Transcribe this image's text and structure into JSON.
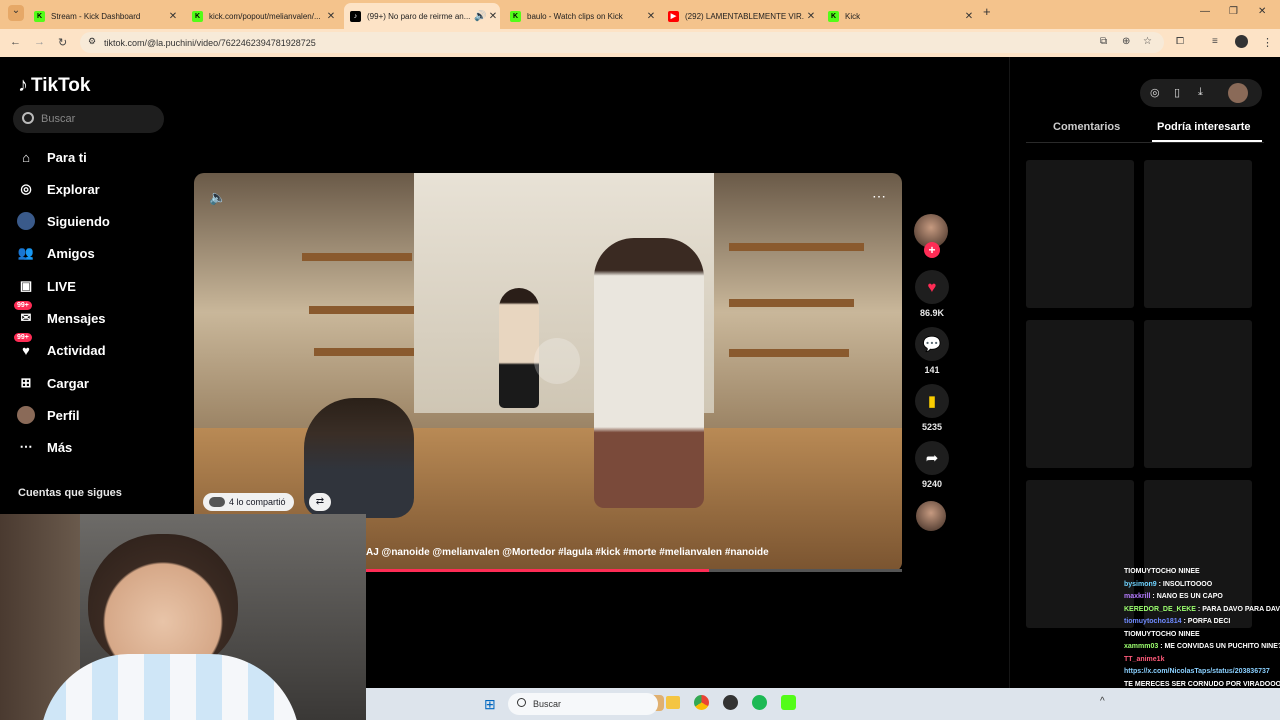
{
  "browser": {
    "tabs": [
      {
        "title": "Stream - Kick Dashboard",
        "favicon_color": "#53fc18",
        "favicon_glyph": "K"
      },
      {
        "title": "kick.com/popout/melianvalen/...",
        "favicon_color": "#53fc18",
        "favicon_glyph": "K"
      },
      {
        "title": "(99+) No paro de reirme an...",
        "favicon_color": "#000000",
        "favicon_glyph": "♪",
        "active": true
      },
      {
        "title": "baulo - Watch clips on Kick",
        "favicon_color": "#53fc18",
        "favicon_glyph": "K"
      },
      {
        "title": "(292) LAMENTABLEMENTE VIR...",
        "favicon_color": "#ff0000",
        "favicon_glyph": "▶"
      },
      {
        "title": "Kick",
        "favicon_color": "#53fc18",
        "favicon_glyph": "K"
      }
    ],
    "new_tab_icon": "plus-icon",
    "url": "tiktok.com/@la.puchini/video/7622462394781928725"
  },
  "sidebar": {
    "logo": "TikTok",
    "search_placeholder": "Buscar",
    "items": [
      {
        "label": "Para ti",
        "icon": "home-icon"
      },
      {
        "label": "Explorar",
        "icon": "compass-icon"
      },
      {
        "label": "Siguiendo",
        "icon": "following-avatar-icon"
      },
      {
        "label": "Amigos",
        "icon": "friends-icon"
      },
      {
        "label": "LIVE",
        "icon": "live-icon"
      },
      {
        "label": "Mensajes",
        "icon": "messages-icon",
        "badge": "99+"
      },
      {
        "label": "Actividad",
        "icon": "activity-icon",
        "badge": "99+"
      },
      {
        "label": "Cargar",
        "icon": "upload-icon"
      },
      {
        "label": "Perfil",
        "icon": "profile-avatar-icon"
      },
      {
        "label": "Más",
        "icon": "more-icon"
      }
    ],
    "following_heading": "Cuentas que sigues"
  },
  "video": {
    "caption": "AJ @nanoide @melianvalen @Mortedor #lagula #kick #morte #melianvalen #nanoide",
    "share_chip": "4 lo compartió",
    "progress": 0.64
  },
  "actions": {
    "likes": "86.9K",
    "comments": "141",
    "saves": "5235",
    "shares": "9240"
  },
  "right_panel": {
    "tabs": [
      "Comentarios",
      "Podría interesarte"
    ],
    "active_tab": "Podría interesarte"
  },
  "taskbar": {
    "search_placeholder": "Buscar"
  },
  "chat": [
    {
      "user": "TIOMUYTOCHO NINEE",
      "msg": "",
      "color": "#ffffff"
    },
    {
      "user": "bysimon9",
      "msg": "INSOLITOOOO",
      "color": "#6fd3ff"
    },
    {
      "user": "maxkrill",
      "msg": "NANO ES UN CAPO",
      "color": "#b57bff"
    },
    {
      "user": "KEREDOR_DE_KEKE",
      "msg": "PARA DAVO PARA DAVO",
      "color": "#9cff6f"
    },
    {
      "user": "tiomuytocho1814",
      "msg": "PORFA DECI",
      "color": "#6f8bff"
    },
    {
      "user": "TIOMUYTOCHO NINEE",
      "msg": "",
      "color": "#ffffff"
    },
    {
      "user": "xammm03",
      "msg": "ME CONVIDAS UN PUCHITO NINE???",
      "color": "#9cff6f"
    },
    {
      "user": "TT_anime1k",
      "msg": "",
      "color": "#ff5a7a"
    },
    {
      "user": "https://x.com/NicolasTaps/status/203836737",
      "msg": "",
      "color": "#8ad0ff"
    },
    {
      "user": "TE MERECES SER CORNUDO POR VIRADOOO",
      "msg": "",
      "color": "#ffffff"
    }
  ]
}
